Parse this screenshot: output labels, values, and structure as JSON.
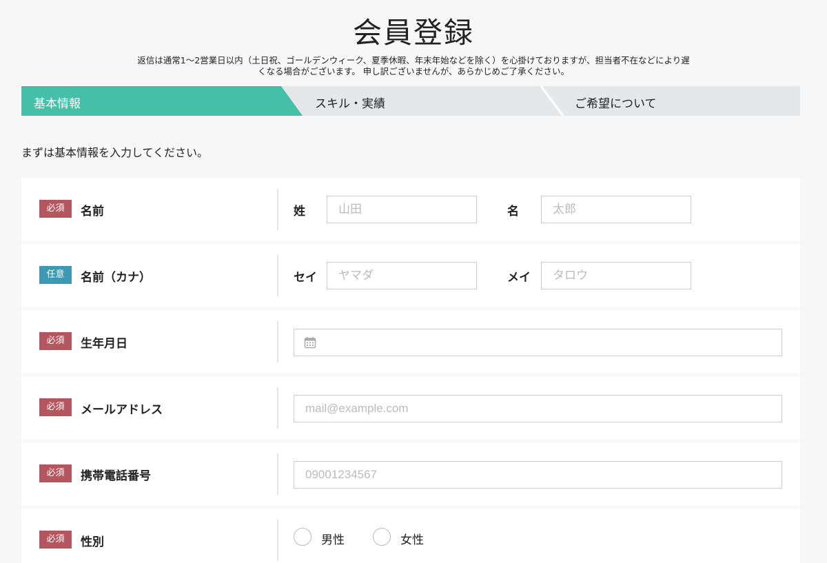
{
  "page": {
    "title": "会員登録",
    "notice_line1": "返信は通常1〜2営業日以内（土日祝、ゴールデンウィーク、夏季休暇、年末年始などを除く）を心掛けておりますが、担当者不在などにより遅",
    "notice_line2": "くなる場合がございます。 申し訳ございませんが、あらかじめご了承ください。"
  },
  "steps": [
    {
      "label": "基本情報",
      "active": true
    },
    {
      "label": "スキル・実績",
      "active": false
    },
    {
      "label": "ご希望について",
      "active": false
    }
  ],
  "intro": "まずは基本情報を入力してください。",
  "colors": {
    "accent": "#46bfa8",
    "required_badge": "#b5555f",
    "optional_badge": "#3a9ab3",
    "step_inactive": "#e6e7e9"
  },
  "form": {
    "name": {
      "badge": "必須",
      "label": "名前",
      "last_label": "姓",
      "last_placeholder": "山田",
      "first_label": "名",
      "first_placeholder": "太郎"
    },
    "kana": {
      "badge": "任意",
      "label": "名前（カナ）",
      "last_label": "セイ",
      "last_placeholder": "ヤマダ",
      "first_label": "メイ",
      "first_placeholder": "タロウ"
    },
    "birthday": {
      "badge": "必須",
      "label": "生年月日",
      "icon": "calendar-icon"
    },
    "email": {
      "badge": "必須",
      "label": "メールアドレス",
      "placeholder": "mail@example.com"
    },
    "phone": {
      "badge": "必須",
      "label": "携帯電話番号",
      "placeholder": "09001234567"
    },
    "gender": {
      "badge": "必須",
      "label": "性別",
      "options": [
        "男性",
        "女性"
      ]
    }
  }
}
